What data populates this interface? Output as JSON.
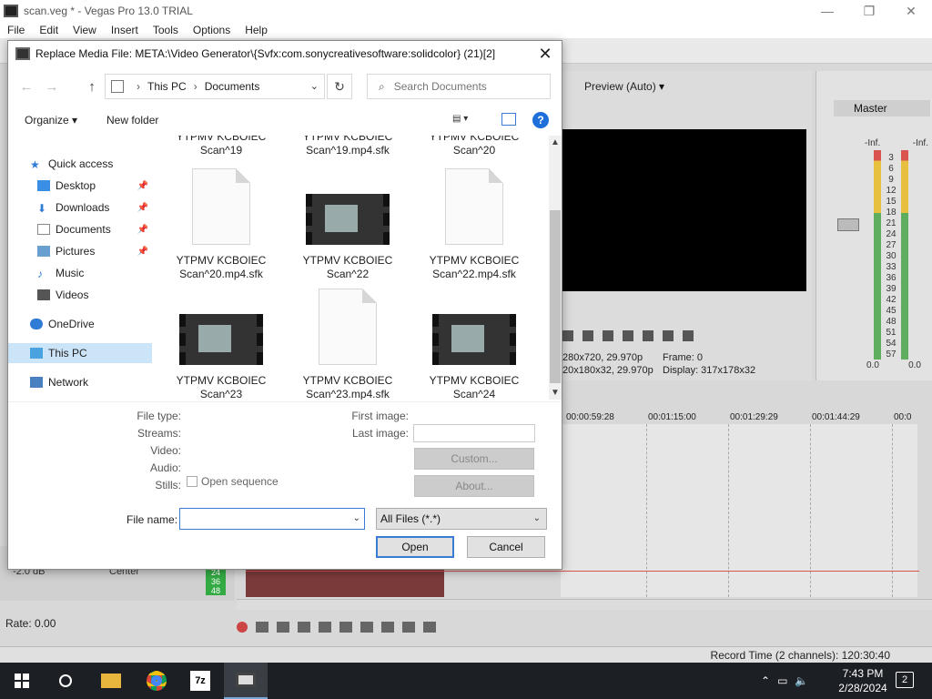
{
  "app": {
    "title": "scan.veg * - Vegas Pro 13.0 TRIAL",
    "menu": [
      "File",
      "Edit",
      "View",
      "Insert",
      "Tools",
      "Options",
      "Help"
    ],
    "preview": {
      "mode": "Preview (Auto)",
      "info_left_1": "280x720, 29.970p",
      "info_left_2": "20x180x32, 29.970p",
      "frame": "Frame:  0",
      "display": "Display:  317x178x32"
    },
    "mixer": {
      "label": "Master",
      "inf_left": "-Inf.",
      "inf_right": "-Inf.",
      "scale": [
        "3",
        "6",
        "9",
        "12",
        "15",
        "18",
        "21",
        "24",
        "27",
        "30",
        "33",
        "36",
        "39",
        "42",
        "45",
        "48",
        "51",
        "54",
        "57"
      ],
      "zero_left": "0.0",
      "zero_right": "0.0"
    },
    "timeline": {
      "ruler": [
        "00:00:59:28",
        "00:01:15:00",
        "00:01:29:29",
        "00:01:44:29",
        "00:0"
      ],
      "track_db": "-2.0 dB",
      "track_center": "Center",
      "track_nums": [
        "24",
        "36",
        "48"
      ]
    },
    "rate": "Rate: 0.00",
    "record_time": "Record Time (2 channels): 120:30:40"
  },
  "dialog": {
    "title": "Replace Media File: META:\\Video Generator\\{Svfx:com.sonycreativesoftware:solidcolor} (21)[2]",
    "breadcrumb": [
      "This PC",
      "Documents"
    ],
    "search_placeholder": "Search Documents",
    "organize": "Organize",
    "new_folder": "New folder",
    "nav": {
      "quick_access": "Quick access",
      "desktop": "Desktop",
      "downloads": "Downloads",
      "documents": "Documents",
      "pictures": "Pictures",
      "music": "Music",
      "videos": "Videos",
      "onedrive": "OneDrive",
      "this_pc": "This PC",
      "network": "Network"
    },
    "files": [
      {
        "line1": "YTPMV KCBOIEC",
        "line2": "Scan^19",
        "kind": "partial"
      },
      {
        "line1": "YTPMV KCBOIEC",
        "line2": "Scan^19.mp4.sfk",
        "kind": "partial"
      },
      {
        "line1": "YTPMV KCBOIEC",
        "line2": "Scan^20",
        "kind": "partial"
      },
      {
        "line1": "YTPMV KCBOIEC",
        "line2": "Scan^20.mp4.sfk",
        "kind": "doc"
      },
      {
        "line1": "YTPMV KCBOIEC",
        "line2": "Scan^22",
        "kind": "video"
      },
      {
        "line1": "YTPMV KCBOIEC",
        "line2": "Scan^22.mp4.sfk",
        "kind": "doc"
      },
      {
        "line1": "YTPMV KCBOIEC",
        "line2": "Scan^23",
        "kind": "video"
      },
      {
        "line1": "YTPMV KCBOIEC",
        "line2": "Scan^23.mp4.sfk",
        "kind": "doc"
      },
      {
        "line1": "YTPMV KCBOIEC",
        "line2": "Scan^24",
        "kind": "video"
      }
    ],
    "details": {
      "file_type": "File type:",
      "streams": "Streams:",
      "video": "Video:",
      "audio": "Audio:",
      "stills": "Stills:",
      "open_sequence": "Open sequence",
      "first_image": "First image:",
      "last_image": "Last image:",
      "custom": "Custom...",
      "about": "About..."
    },
    "file_name_label": "File name:",
    "file_name_value": "",
    "filter": "All Files (*.*)",
    "open": "Open",
    "cancel": "Cancel"
  },
  "taskbar": {
    "time": "7:43 PM",
    "date": "2/28/2024",
    "notifications": "2",
    "sevenzip": "7z"
  }
}
